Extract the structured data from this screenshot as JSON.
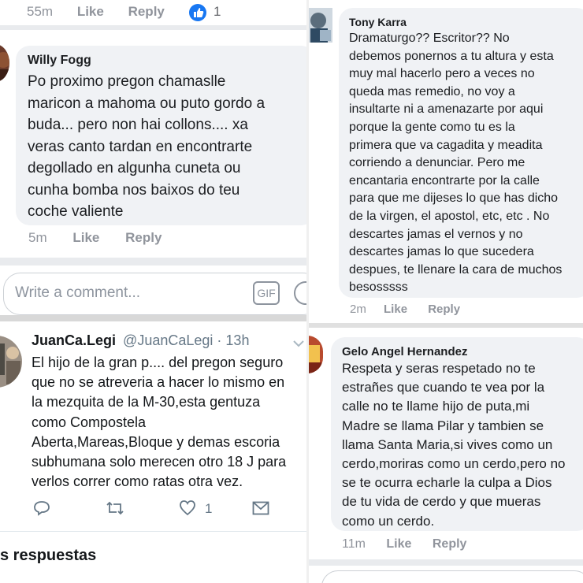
{
  "top_left": {
    "meta": {
      "time": "55m",
      "like": "Like",
      "reply": "Reply",
      "reaction_count": "1"
    }
  },
  "willy": {
    "name": "Willy Fogg",
    "text": "Po proximo pregon chamaslle\nmaricon a mahoma ou puto gordo a\nbuda... pero non hai collons.... xa\nveras canto tardan en encontrarte\ndegollado en algunha cuneta ou\ncunha bomba nos baixos do teu\ncoche valiente",
    "meta": {
      "time": "5m",
      "like": "Like",
      "reply": "Reply"
    }
  },
  "composer": {
    "placeholder": "Write a comment...",
    "gif": "GIF"
  },
  "tweet": {
    "name": "JuanCa.Legi",
    "handle": "@JuanCaLegi",
    "time": "· 13h",
    "text": "El hijo de la gran p.... del pregon seguro\nque no se atreveria a hacer lo mismo en\nla mezquita de la M-30,esta gentuza\ncomo Compostela\nAberta,Mareas,Bloque y demas escoria\nsubhumana solo merecen otro 18 J para\nverlos correr como ratas otra vez.",
    "like_count": "1",
    "footer": "s respuestas"
  },
  "tony": {
    "name": "Tony Karra",
    "text": "Dramaturgo?? Escritor?? No\ndebemos ponernos a tu altura y esta\nmuy mal hacerlo pero a veces no\nqueda mas remedio, no voy a\ninsultarte ni a amenazarte por aqui\nporque la gente como tu es la\nprimera que va cagadita y meadita\ncorriendo a denunciar. Pero me\nencantaria encontrarte por la calle\npara que me dijeses lo que has dicho\nde la virgen, el apostol, etc, etc . No\ndescartes jamas el vernos y no\ndescartes jamas lo que sucedera\ndespues, te llenare la cara de muchos\nbesosssss",
    "meta": {
      "time": "2m",
      "like": "Like",
      "reply": "Reply"
    }
  },
  "gelo": {
    "name": "Gelo Angel Hernandez",
    "text": "Respeta y seras respetado no te\nestrañes que cuando te vea por la\ncalle no te llame hijo de puta,mi\nMadre se llama Pilar y tambien se\nllama Santa Maria,si vives como un\ncerdo,moriras como un cerdo,pero no\nse te ocurra echarle la culpa a Dios\nde tu vida de cerdo y que mueras\ncomo un cerdo.",
    "meta": {
      "time": "11m",
      "like": "Like",
      "reply": "Reply"
    }
  },
  "colors": {
    "accent": "#1877f2",
    "bubble": "#f0f2f5",
    "meta": "#90949c"
  }
}
